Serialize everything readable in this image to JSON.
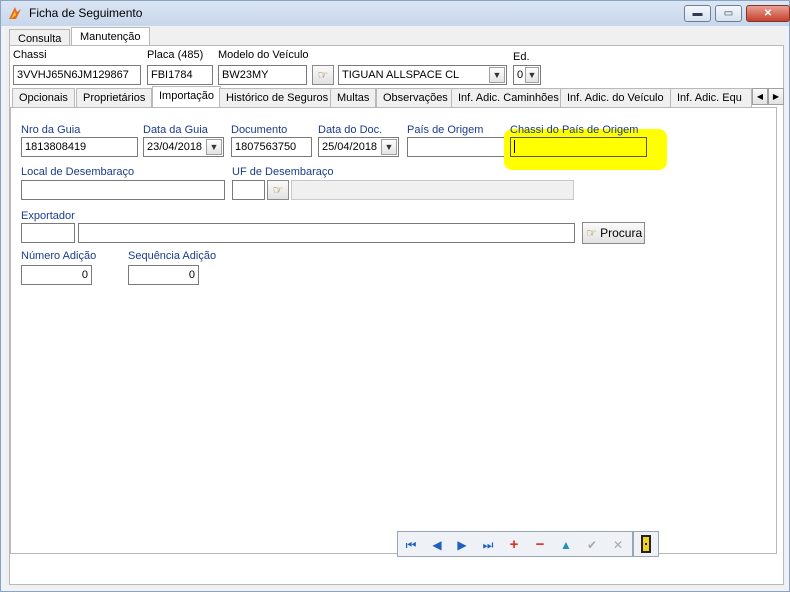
{
  "window": {
    "title": "Ficha de Seguimento",
    "minimize": "▬",
    "maximize": "▭",
    "close": "✕"
  },
  "top_tabs": [
    "Consulta",
    "Manutenção"
  ],
  "header": {
    "chassi_label": "Chassi",
    "chassi_value": "3VVHJ65N6JM129867",
    "placa_label": "Placa (485)",
    "placa_value": "FBI1784",
    "modelo_label": "Modelo do Veículo",
    "modelo_value": "BW23MY",
    "modelo_desc": "TIGUAN ALLSPACE CL",
    "ed_label": "Ed.",
    "ed_value": "0"
  },
  "inner_tabs": [
    "Opcionais",
    "Proprietários",
    "Importação",
    "Histórico de Seguros",
    "Multas",
    "Observações",
    "Inf. Adic. Caminhões",
    "Inf. Adic. do Veículo",
    "Inf. Adic. Equ"
  ],
  "importacao": {
    "nro_guia_label": "Nro da Guia",
    "nro_guia_value": "1813808419",
    "data_guia_label": "Data da Guia",
    "data_guia_value": "23/04/2018",
    "documento_label": "Documento",
    "documento_value": "1807563750",
    "data_doc_label": "Data do Doc.",
    "data_doc_value": "25/04/2018",
    "pais_origem_label": "País de Origem",
    "pais_origem_value": "",
    "chassi_pais_label": "Chassi do País de Origem",
    "chassi_pais_value": "",
    "local_desembaraco_label": "Local de Desembaraço",
    "local_desembaraco_value": "",
    "uf_desembaraco_label": "UF de Desembaraço",
    "uf_desembaraco_value": "",
    "exportador_label": "Exportador",
    "exportador_code": "",
    "exportador_name": "",
    "procura_label": "Procura",
    "numero_adicao_label": "Número Adição",
    "numero_adicao_value": "0",
    "sequencia_adicao_label": "Sequência Adição",
    "sequencia_adicao_value": "0"
  },
  "navigator": {
    "first": "⏮",
    "prior": "◀",
    "next": "▶",
    "last": "⏭",
    "insert": "+",
    "delete": "−",
    "edit": "▲",
    "post": "✔",
    "cancel": "✕"
  },
  "colors": {
    "highlight": "#ffff00",
    "label_blue": "#1a3c8c",
    "nav_blue": "#1f5fbf",
    "nav_red": "#e0301e"
  }
}
